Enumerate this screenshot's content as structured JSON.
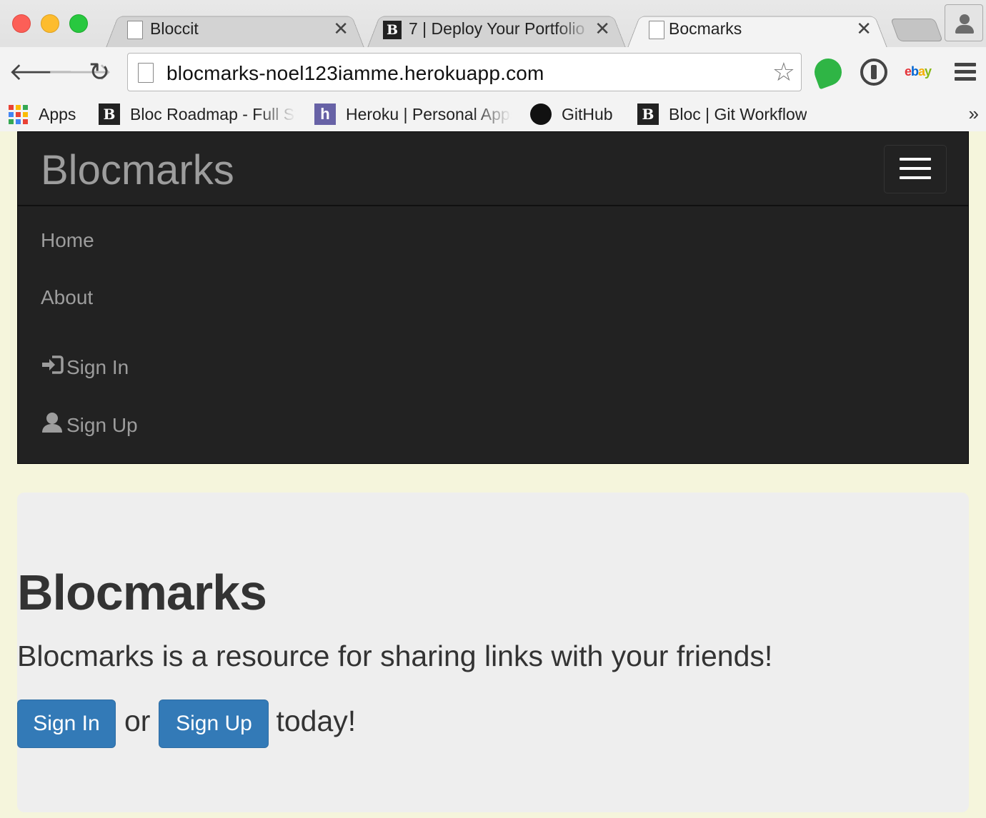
{
  "browser": {
    "tabs": [
      {
        "title": "Bloccit",
        "icon": "page-icon",
        "active": false
      },
      {
        "title": "7 | Deploy Your Portfolio",
        "icon": "bloc-icon",
        "active": false
      },
      {
        "title": "Bocmarks",
        "icon": "page-icon",
        "active": true
      }
    ],
    "tab_close_glyph": "✕",
    "url": "blocmarks-noel123iamme.herokuapp.com",
    "bookmarks": [
      {
        "label": "Apps",
        "icon": "apps-grid-icon"
      },
      {
        "label": "Bloc Roadmap - Full Stack",
        "icon": "bloc-icon"
      },
      {
        "label": "Heroku | Personal Apps",
        "icon": "heroku-icon"
      },
      {
        "label": "GitHub",
        "icon": "github-icon"
      },
      {
        "label": "Bloc | Git Workflow",
        "icon": "bloc-icon"
      }
    ],
    "extensions": {
      "ebay": "ebay"
    }
  },
  "navbar": {
    "brand": "Blocmarks",
    "links": {
      "home": "Home",
      "about": "About",
      "sign_in": "Sign In",
      "sign_up": "Sign Up"
    }
  },
  "jumbotron": {
    "title": "Blocmarks",
    "lead": "Blocmarks is a resource for sharing links with your friends!",
    "sign_in_button": "Sign In",
    "connector": "or",
    "sign_up_button": "Sign Up",
    "suffix": "today!"
  },
  "colors": {
    "page_bg": "#f5f5dc",
    "navbar_bg": "#222222",
    "navbar_text": "#9d9d9d",
    "jumbotron_bg": "#eeeeee",
    "primary_button": "#337ab7"
  }
}
